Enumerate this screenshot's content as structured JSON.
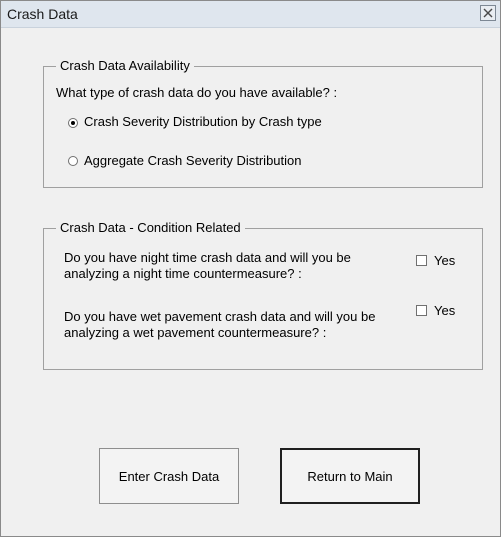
{
  "window": {
    "title": "Crash Data",
    "close_icon": "close-icon"
  },
  "availability": {
    "group_label": "Crash Data Availability",
    "question": "What type of crash data do you have available? :",
    "options": [
      {
        "label": "Crash Severity Distribution by Crash type",
        "selected": true
      },
      {
        "label": "Aggregate Crash Severity Distribution",
        "selected": false
      }
    ]
  },
  "condition": {
    "group_label": "Crash Data - Condition Related",
    "night": {
      "question_line1": "Do you have night time crash data and will you be",
      "question_line2": "analyzing a night time countermeasure? :",
      "checkbox_label": "Yes",
      "checked": false
    },
    "wet": {
      "question_line1": "Do you have wet pavement crash data and will you be",
      "question_line2": "analyzing a wet pavement countermeasure? :",
      "checkbox_label": "Yes",
      "checked": false
    }
  },
  "buttons": {
    "enter_label": "Enter Crash Data",
    "return_label": "Return to Main"
  }
}
